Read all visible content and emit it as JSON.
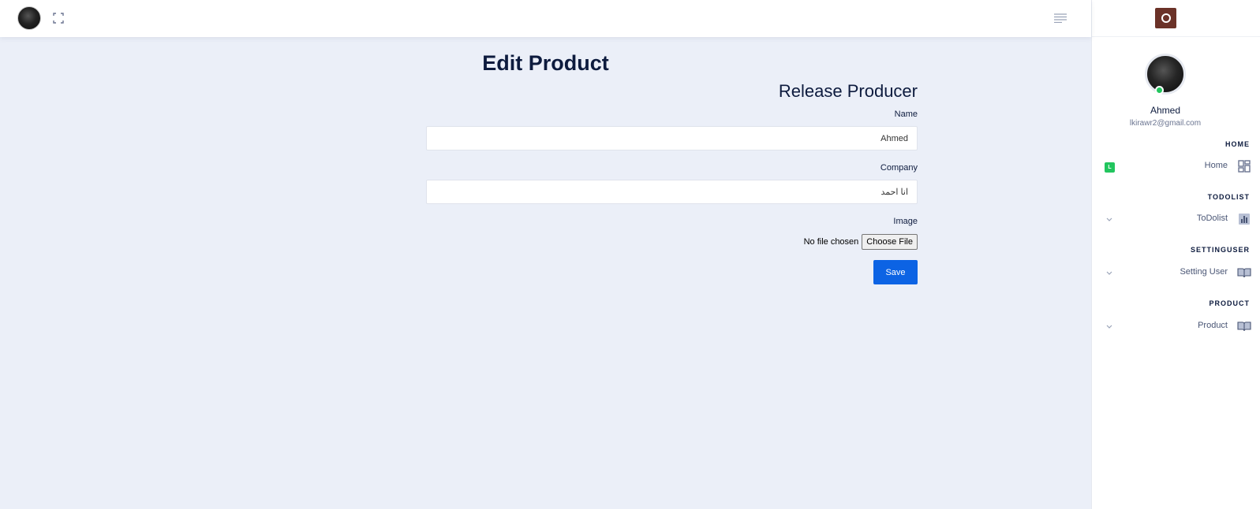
{
  "header": {
    "avatar_icon": "user-avatar",
    "fullscreen_icon": "fullscreen-icon",
    "menu_icon": "menu-lines-icon"
  },
  "main": {
    "page_title": "Edit Product",
    "form": {
      "title": "Release Producer",
      "name_label": "Name",
      "name_value": "Ahmed",
      "company_label": "Company",
      "company_value": "انا احمد",
      "image_label": "Image",
      "file_status": "No file chosen",
      "choose_file_label": "Choose File",
      "save_label": "Save"
    }
  },
  "sidebar": {
    "profile": {
      "name": "Ahmed",
      "email": "lkirawr2@gmail.com"
    },
    "sections": [
      {
        "heading": "HOME",
        "item": "Home",
        "icon": "dashboard-icon",
        "badge": "L"
      },
      {
        "heading": "TODOLIST",
        "item": "ToDolist",
        "icon": "chart-icon"
      },
      {
        "heading": "SETTINGUSER",
        "item": "Setting User",
        "icon": "book-icon"
      },
      {
        "heading": "PRODUCT",
        "item": "Product",
        "icon": "book-icon"
      }
    ]
  },
  "colors": {
    "background": "#ebeff8",
    "primary_button": "#0c63e4",
    "online": "#22c55e",
    "text_dark": "#0d1b3e"
  }
}
